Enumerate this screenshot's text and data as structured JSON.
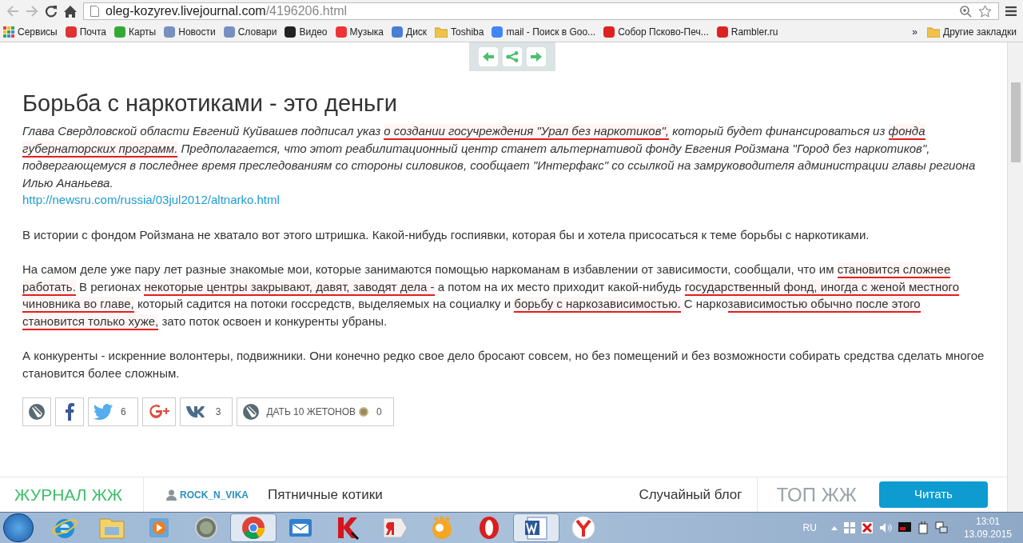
{
  "browser": {
    "url_host": "oleg-kozyrev.livejournal.com",
    "url_path": "/4196206.html"
  },
  "bookmarks": [
    {
      "label": "Сервисы",
      "kind": "apps"
    },
    {
      "label": "Почта",
      "kind": "mail"
    },
    {
      "label": "Карты",
      "kind": "maps"
    },
    {
      "label": "Новости",
      "kind": "doc"
    },
    {
      "label": "Словари",
      "kind": "doc"
    },
    {
      "label": "Видео",
      "kind": "video"
    },
    {
      "label": "Музыка",
      "kind": "music"
    },
    {
      "label": "Диск",
      "kind": "disk"
    },
    {
      "label": "Toshiba",
      "kind": "folder"
    },
    {
      "label": "mail - Поиск в Goo...",
      "kind": "google"
    },
    {
      "label": "Собор Псково-Печ...",
      "kind": "yandex"
    },
    {
      "label": "Rambler.ru",
      "kind": "yandex"
    }
  ],
  "bookmarks_more": "»",
  "other_bookmarks": "Другие закладки",
  "article": {
    "title": "Борьба с наркотиками - это деньги",
    "paragraphs": [
      {
        "italic": true,
        "segments": [
          {
            "text": "Глава Свердловской области Евгений Куйвашев подписал указ ",
            "underlined": false
          },
          {
            "text": "о создании госучреждения \"Урал без наркотиков\",",
            "underlined": true
          },
          {
            "text": " который будет финансироваться из ",
            "underlined": false
          },
          {
            "text": "фонда губернаторских программ.",
            "underlined": true
          },
          {
            "text": " Предполагается, что этот реабилитационный центр станет альтернативой фонду Евгения Ройзмана \"Город без наркотиков\", подвергающемуся в последнее время преследованиям со стороны силовиков, сообщает \"Интерфакс\" со ссылкой на замруководителя администрации главы региона Илью Ананьева.",
            "underlined": false
          }
        ],
        "link": "http://newsru.com/russia/03jul2012/altnarko.html"
      },
      {
        "italic": false,
        "segments": [
          {
            "text": "В истории с фондом Ройзмана не хватало вот этого штришка. Какой-нибудь госпиявки, которая бы и хотела присосаться к теме борьбы с наркотиками.",
            "underlined": false
          }
        ]
      },
      {
        "italic": false,
        "segments": [
          {
            "text": "На самом деле уже пару лет разные знакомые мои, которые занимаются помощью наркоманам в избавлении от зависимости, сообщали, что им ",
            "underlined": false
          },
          {
            "text": "становится сложнее работать.",
            "underlined": true
          },
          {
            "text": " В регионах ",
            "underlined": false
          },
          {
            "text": "некоторые центры закрывают, давят, заводят дела -",
            "underlined": true
          },
          {
            "text": " а потом на их место приходит какой-нибудь ",
            "underlined": false
          },
          {
            "text": "государственный фонд, иногда с женой местного чиновника во главе,",
            "underlined": true
          },
          {
            "text": " который садится на потоки госсредств, выделяемых на социалку и ",
            "underlined": false
          },
          {
            "text": "борьбу с наркозависимостью.",
            "underlined": true
          },
          {
            "text": " С нарко",
            "underlined": false
          },
          {
            "text": "зависимостью обычно после этого становится только хуже,",
            "underlined": true
          },
          {
            "text": " зато поток освоен и конкуренты убраны.",
            "underlined": false
          }
        ]
      },
      {
        "italic": false,
        "segments": [
          {
            "text": "А конкуренты - искренние волонтеры, подвижники. Они конечно редко свое дело бросают совсем, но без помещений и без возможности собирать средства сделать многое становится более сложным.",
            "underlined": false
          }
        ]
      }
    ]
  },
  "share_buttons": [
    {
      "kind": "lj"
    },
    {
      "kind": "facebook"
    },
    {
      "kind": "twitter",
      "count": "6"
    },
    {
      "kind": "googleplus"
    },
    {
      "kind": "vk",
      "count": "3"
    },
    {
      "kind": "tokens",
      "label": "ДАТЬ 10 ЖЕТОНОВ",
      "count": "0"
    }
  ],
  "footer": {
    "brand": "ЖУРНАЛ ЖЖ",
    "user": "ROCK_N_VIKA",
    "post": "Пятничные котики",
    "random": "Случайный блог",
    "top": "ТОП ЖЖ",
    "read_button": "Читать"
  },
  "taskbar": {
    "apps": [
      {
        "kind": "ie",
        "selected": false
      },
      {
        "kind": "explorer",
        "selected": false
      },
      {
        "kind": "media",
        "selected": false
      },
      {
        "kind": "disc",
        "selected": false
      },
      {
        "kind": "chrome",
        "selected": true
      },
      {
        "kind": "mail",
        "selected": false
      },
      {
        "kind": "kaspersky",
        "selected": false
      },
      {
        "kind": "yandex",
        "selected": false
      },
      {
        "kind": "bubble",
        "selected": false
      },
      {
        "kind": "opera",
        "selected": false
      },
      {
        "kind": "word",
        "selected": true
      },
      {
        "kind": "yabrowser",
        "selected": false
      }
    ],
    "lang": "RU",
    "time": "13:01",
    "date": "13.09.2015"
  }
}
